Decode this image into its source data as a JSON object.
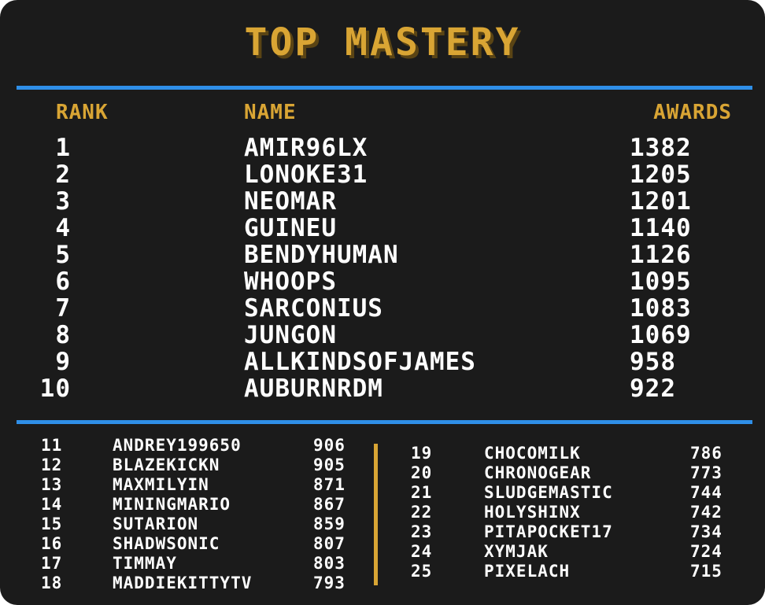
{
  "title": "TOP MASTERY",
  "headers": {
    "rank": "RANK",
    "name": "NAME",
    "awards": "AWARDS"
  },
  "colors": {
    "accent_gold": "#d9a534",
    "divider_blue": "#2f8fe8",
    "background": "#1b1b1b",
    "text": "#ffffff"
  },
  "top_entries": [
    {
      "rank": "1",
      "name": "AMIR96LX",
      "awards": "1382"
    },
    {
      "rank": "2",
      "name": "LONOKE31",
      "awards": "1205"
    },
    {
      "rank": "3",
      "name": "NEOMAR",
      "awards": "1201"
    },
    {
      "rank": "4",
      "name": "GUINEU",
      "awards": "1140"
    },
    {
      "rank": "5",
      "name": "BENDYHUMAN",
      "awards": "1126"
    },
    {
      "rank": "6",
      "name": "WHOOPS",
      "awards": "1095"
    },
    {
      "rank": "7",
      "name": "SARCONIUS",
      "awards": "1083"
    },
    {
      "rank": "8",
      "name": "JUNGON",
      "awards": "1069"
    },
    {
      "rank": "9",
      "name": "ALLKINDSOFJAMES",
      "awards": "958"
    },
    {
      "rank": "10",
      "name": "AUBURNRDM",
      "awards": "922"
    }
  ],
  "more_entries_left": [
    {
      "rank": "11",
      "name": "ANDREY199650",
      "awards": "906"
    },
    {
      "rank": "12",
      "name": "BLAZEKICKN",
      "awards": "905"
    },
    {
      "rank": "13",
      "name": "MAXMILYIN",
      "awards": "871"
    },
    {
      "rank": "14",
      "name": "MININGMARIO",
      "awards": "867"
    },
    {
      "rank": "15",
      "name": "SUTARION",
      "awards": "859"
    },
    {
      "rank": "16",
      "name": "SHADWSONIC",
      "awards": "807"
    },
    {
      "rank": "17",
      "name": "TIMMAY",
      "awards": "803"
    },
    {
      "rank": "18",
      "name": "MADDIEKITTYTV",
      "awards": "793"
    }
  ],
  "more_entries_right": [
    {
      "rank": "19",
      "name": "CHOCOMILK",
      "awards": "786"
    },
    {
      "rank": "20",
      "name": "CHRONOGEAR",
      "awards": "773"
    },
    {
      "rank": "21",
      "name": "SLUDGEMASTIC",
      "awards": "744"
    },
    {
      "rank": "22",
      "name": "HOLYSHINX",
      "awards": "742"
    },
    {
      "rank": "23",
      "name": "PITAPOCKET17",
      "awards": "734"
    },
    {
      "rank": "24",
      "name": "XYMJAK",
      "awards": "724"
    },
    {
      "rank": "25",
      "name": "PIXELACH",
      "awards": "715"
    }
  ]
}
